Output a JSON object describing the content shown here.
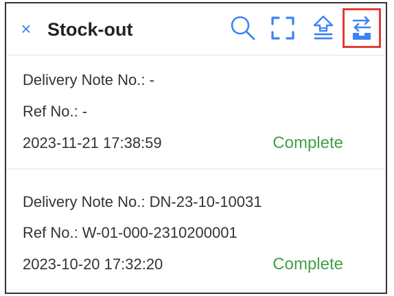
{
  "header": {
    "close_glyph": "×",
    "title": "Stock-out",
    "icons": [
      "close-icon",
      "search-icon",
      "scan-icon",
      "upload-icon",
      "transfer-icon"
    ],
    "accent_color": "#3b82f6",
    "highlight_color": "#e53935"
  },
  "records": [
    {
      "delivery_note": "Delivery Note No.: -",
      "ref_no": "Ref No.: -",
      "datetime": "2023-11-21 17:38:59",
      "status": "Complete"
    },
    {
      "delivery_note": "Delivery Note No.: DN-23-10-10031",
      "ref_no": "Ref No.: W-01-000-2310200001",
      "datetime": "2023-10-20 17:32:20",
      "status": "Complete"
    }
  ],
  "status_color": "#43a047"
}
